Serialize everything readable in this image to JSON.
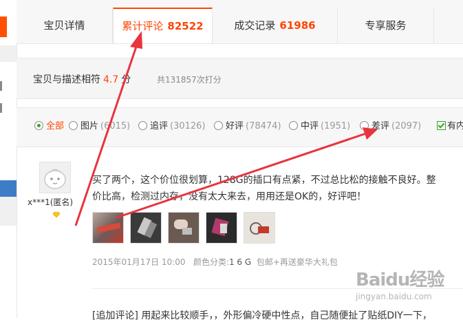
{
  "tabs": [
    {
      "label": "宝贝详情",
      "count": ""
    },
    {
      "label": "累计评论",
      "count": "82522"
    },
    {
      "label": "成交记录",
      "count": "61986"
    },
    {
      "label": "专享服务",
      "count": ""
    }
  ],
  "score": {
    "label": "宝贝与描述相符",
    "value": "4.7",
    "unit": "分",
    "total": "共131857次打分"
  },
  "filters": [
    {
      "label": "全部",
      "count": "",
      "selected": true
    },
    {
      "label": "图片",
      "count": "(6015)",
      "selected": false
    },
    {
      "label": "追评",
      "count": "(30126)",
      "selected": false
    },
    {
      "label": "好评",
      "count": "(78474)",
      "selected": false
    },
    {
      "label": "中评",
      "count": "(1951)",
      "selected": false
    },
    {
      "label": "差评",
      "count": "(2097)",
      "selected": false
    }
  ],
  "content_filter_label": "有内",
  "review": {
    "user": "x***1(匿名)",
    "line1": "买了两个，这个价位很划算，128G的插口有点紧，不过总比松的接触不良好。整",
    "line2": "价比高，检测过内存，没有太大来去，用用还是OK的，好评吧！",
    "date": "2015年01月17日 10:00",
    "spec_label": "颜色分类:",
    "spec_value": "1 6 G",
    "extra": "包邮+再送豪华大礼包",
    "append": "[追加评论] 用起来比较顺手，，外形偏冷硬中性点，自己随便扯了贴纸DIY一下，"
  },
  "watermark": {
    "logo": "Baidu经验",
    "sub": "jingyan.baidu.com"
  },
  "colors": {
    "accent": "#ff4400",
    "arrow": "#e8343c",
    "radio_on": "#3aa61f"
  }
}
